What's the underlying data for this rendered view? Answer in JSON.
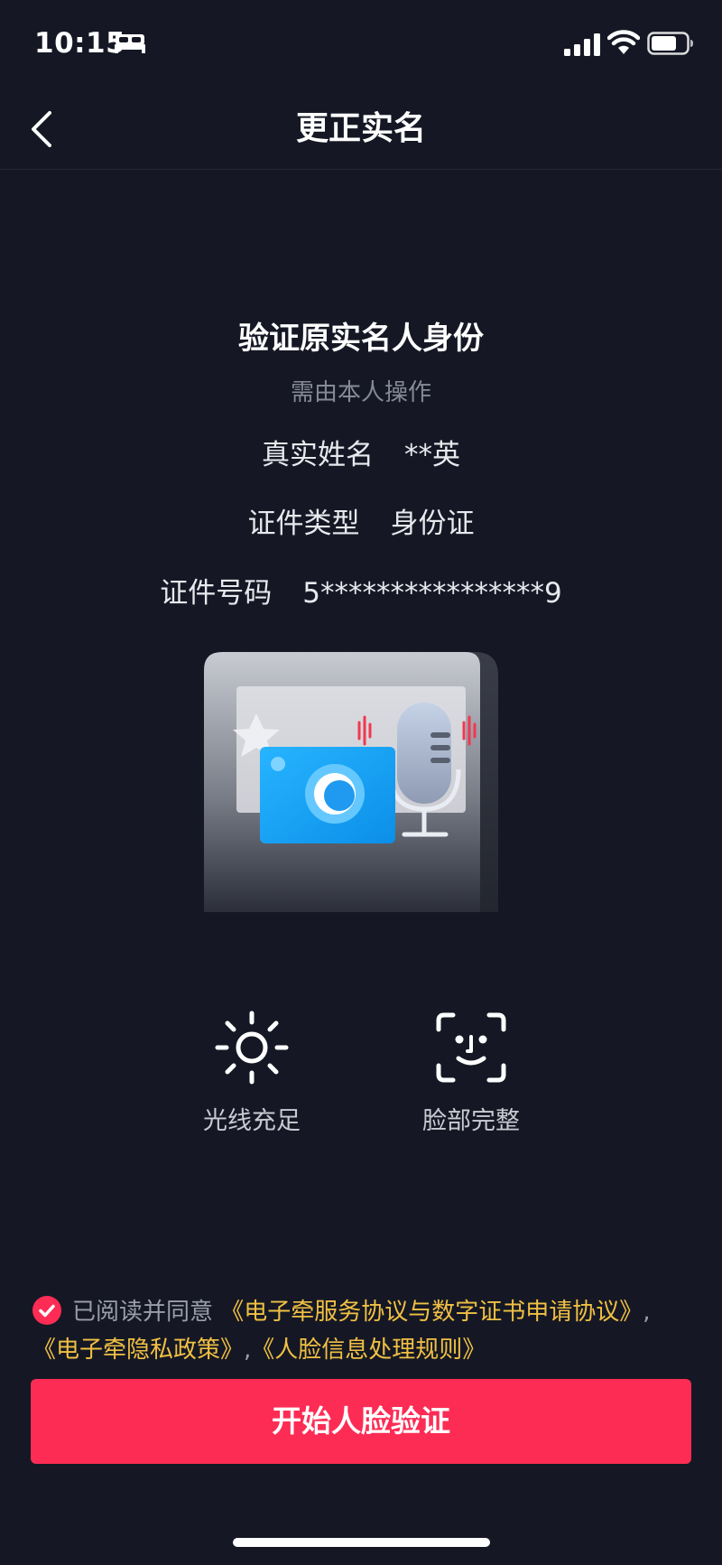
{
  "status_bar": {
    "time": "10:15",
    "icons": [
      "bed-icon",
      "signal-icon",
      "wifi-icon",
      "battery-icon"
    ]
  },
  "nav": {
    "title": "更正实名",
    "back_icon": "chevron-left-icon"
  },
  "verify": {
    "heading": "验证原实名人身份",
    "subheading": "需由本人操作",
    "fields": [
      {
        "label": "真实姓名",
        "value": "**英"
      },
      {
        "label": "证件类型",
        "value": "身份证"
      },
      {
        "label": "证件号码",
        "value": "5****************9"
      }
    ]
  },
  "tips": [
    {
      "label": "光线充足",
      "icon": "sun-icon"
    },
    {
      "label": "脸部完整",
      "icon": "face-scan-icon"
    }
  ],
  "agreement": {
    "checked": true,
    "prefix": "已阅读并同意",
    "links": [
      "《电子牵服务协议与数字证书申请协议》",
      "《电子牵隐私政策》",
      "《人脸信息处理规则》"
    ],
    "separator": ","
  },
  "primary_button": {
    "label": "开始人脸验证"
  },
  "colors": {
    "background": "#151824",
    "accent": "#fd2c55",
    "link": "#f1c044",
    "illustration_blue": "#1ca4f4"
  }
}
